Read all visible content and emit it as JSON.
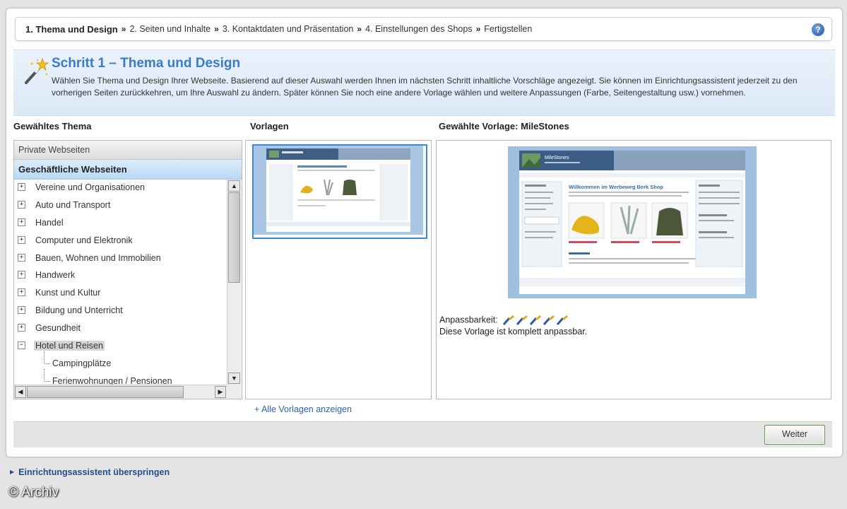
{
  "breadcrumb": {
    "current": "1. Thema und Design",
    "separator": "»",
    "steps": [
      "2. Seiten und Inhalte",
      "3. Kontaktdaten und Präsentation",
      "4. Einstellungen des Shops",
      "Fertigstellen"
    ],
    "help_icon": "question-icon"
  },
  "step": {
    "title": "Schritt 1 – Thema und Design",
    "description": "Wählen Sie Thema und Design Ihrer Webseite. Basierend auf dieser Auswahl werden Ihnen im nächsten Schritt inhaltliche Vorschläge angezeigt. Sie können im Einrichtungsassistent jederzeit zu den vorherigen Seiten zurückkehren, um Ihre Auswahl zu ändern. Später können Sie noch eine andere Vorlage wählen und weitere Anpassungen (Farbe, Seitengestaltung usw.) vornehmen.",
    "icon": "magic-wand-icon"
  },
  "theme": {
    "heading": "Gewähltes Thema",
    "private": "Private Webseiten",
    "business": "Geschäftliche Webseiten",
    "items": [
      {
        "label": "Vereine und Organisationen",
        "state": "collapsed"
      },
      {
        "label": "Auto und Transport",
        "state": "collapsed"
      },
      {
        "label": "Handel",
        "state": "collapsed"
      },
      {
        "label": "Computer und Elektronik",
        "state": "collapsed"
      },
      {
        "label": "Bauen, Wohnen und Immobilien",
        "state": "collapsed"
      },
      {
        "label": "Handwerk",
        "state": "collapsed"
      },
      {
        "label": "Kunst und Kultur",
        "state": "collapsed"
      },
      {
        "label": "Bildung und Unterricht",
        "state": "collapsed"
      },
      {
        "label": "Gesundheit",
        "state": "collapsed"
      },
      {
        "label": "Hotel und Reisen",
        "state": "expanded",
        "selected": true
      },
      {
        "label": "Campingplätze",
        "state": "child"
      },
      {
        "label": "Ferienwohnungen / Pensionen",
        "state": "child"
      }
    ]
  },
  "templates": {
    "heading": "Vorlagen",
    "show_all": "+ Alle Vorlagen anzeigen"
  },
  "preview": {
    "heading": "Gewählte Vorlage: MileStones",
    "site_name": "MileStones",
    "welcome": "Willkommen im Werbeweg Berk Shop",
    "adapt_label": "Anpassbarkeit:",
    "adapt_rating": 5,
    "adapt_max": 5,
    "adapt_desc": "Diese Vorlage ist komplett anpassbar."
  },
  "footer": {
    "next": "Weiter",
    "skip": "Einrichtungsassistent überspringen"
  },
  "watermark": "© Archiv",
  "colors": {
    "accent": "#3a7bc8",
    "band": "#dbe8f6",
    "selected_category": "#b8d8f4",
    "link": "#2a63b0"
  }
}
